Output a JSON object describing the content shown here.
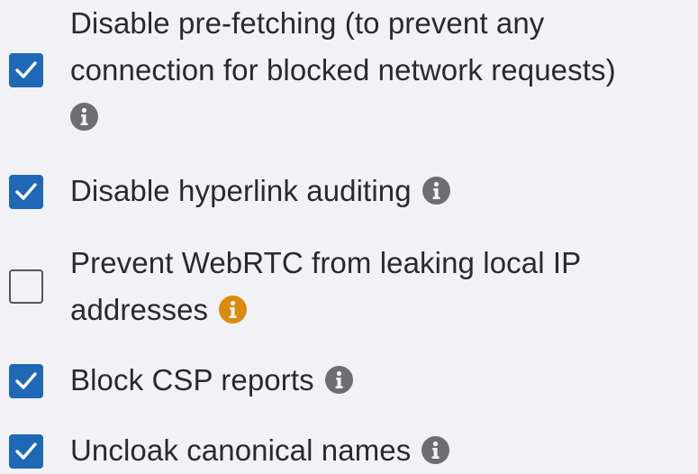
{
  "options": [
    {
      "id": "prefetching",
      "checked": true,
      "lines": [
        "Disable pre-fetching (to prevent any",
        "connection for blocked network requests)",
        ""
      ],
      "info_icon": "info-icon",
      "info_color": "#6d6d72"
    },
    {
      "id": "hyperlink-auditing",
      "checked": true,
      "lines": [
        "Disable hyperlink auditing"
      ],
      "info_icon": "info-icon",
      "info_color": "#6d6d72"
    },
    {
      "id": "webrtc",
      "checked": false,
      "lines": [
        "Prevent WebRTC from leaking local IP",
        "addresses"
      ],
      "info_icon": "info-icon",
      "info_color": "#d98c0b"
    },
    {
      "id": "csp-reports",
      "checked": true,
      "lines": [
        "Block CSP reports"
      ],
      "info_icon": "info-icon",
      "info_color": "#6d6d72"
    },
    {
      "id": "canonical-names",
      "checked": true,
      "lines": [
        "Uncloak canonical names"
      ],
      "info_icon": "info-icon",
      "info_color": "#6d6d72"
    }
  ],
  "colors": {
    "checkbox_checked": "#1e68b5",
    "checkbox_unchecked_border": "#55555b",
    "background": "#f2f2f6",
    "info_default": "#6d6d72",
    "info_warning": "#d98c0b"
  }
}
